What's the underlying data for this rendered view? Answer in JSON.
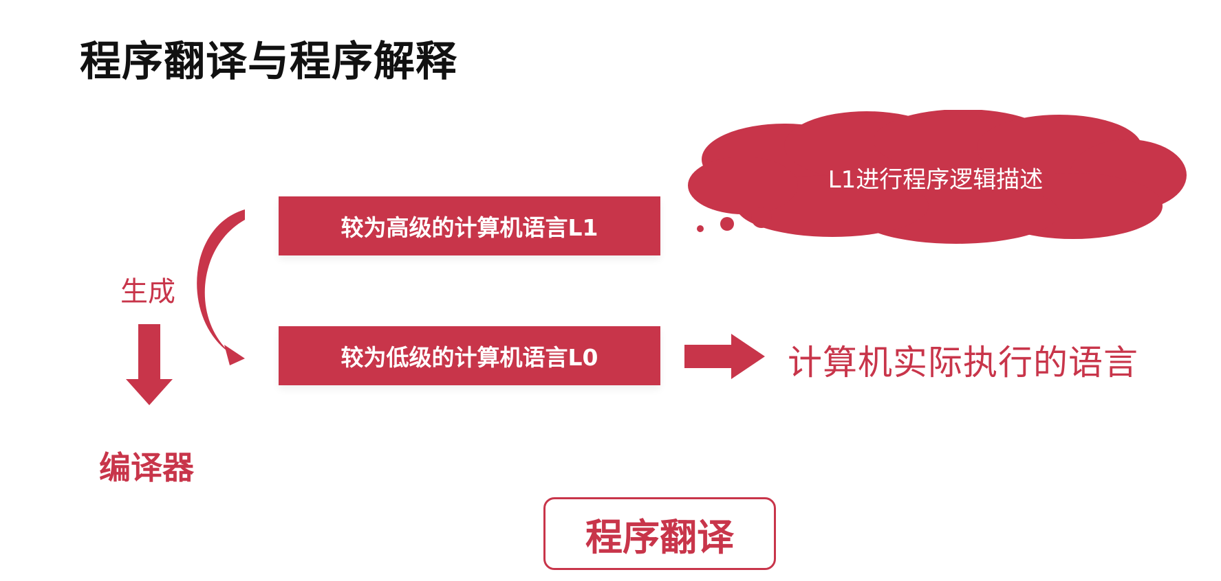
{
  "title": "程序翻译与程序解释",
  "boxes": {
    "l1": "较为高级的计算机语言L1",
    "l0": "较为低级的计算机语言L0"
  },
  "cloud": {
    "text": "L1进行程序逻辑描述"
  },
  "labels": {
    "generate": "生成",
    "compiler": "编译器",
    "executed_language": "计算机实际执行的语言"
  },
  "footer_box": {
    "label": "程序翻译"
  },
  "colors": {
    "accent": "#c8354a",
    "title": "#111111",
    "background": "#ffffff"
  }
}
